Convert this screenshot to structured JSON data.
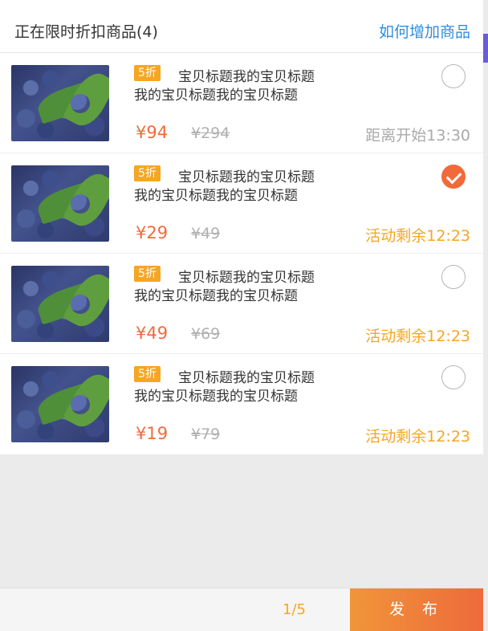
{
  "header": {
    "title": "正在限时折扣商品(4)",
    "link": "如何增加商品"
  },
  "items": [
    {
      "discount": "5折",
      "title_line1": "宝贝标题我的宝贝标题",
      "title_line2": "我的宝贝标题我的宝贝标题",
      "price": "¥94",
      "original_price": "¥294",
      "status": "距离开始13:30",
      "selected": false
    },
    {
      "discount": "5折",
      "title_line1": "宝贝标题我的宝贝标题",
      "title_line2": "我的宝贝标题我的宝贝标题",
      "price": "¥29",
      "original_price": "¥49",
      "status": "活动剩余12:23",
      "selected": true
    },
    {
      "discount": "5折",
      "title_line1": "宝贝标题我的宝贝标题",
      "title_line2": "我的宝贝标题我的宝贝标题",
      "price": "¥49",
      "original_price": "¥69",
      "status": "活动剩余12:23",
      "selected": false
    },
    {
      "discount": "5折",
      "title_line1": "宝贝标题我的宝贝标题",
      "title_line2": "我的宝贝标题我的宝贝标题",
      "price": "¥19",
      "original_price": "¥79",
      "status": "活动剩余12:23",
      "selected": false
    }
  ],
  "footer": {
    "pager": "1/5",
    "publish_label": "发 布"
  },
  "colors": {
    "accent": "#f26a3a",
    "badge": "#f5a623",
    "link": "#2f8ee0"
  }
}
